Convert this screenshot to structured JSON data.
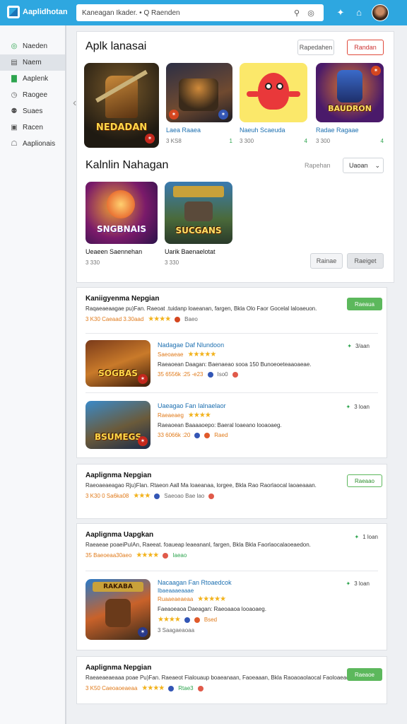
{
  "header": {
    "logo_text": "Aaplidhotan",
    "search_text": "Kaneagan Ikader. • Q Raenden",
    "icons": [
      "search-icon",
      "globe-icon",
      "puzzle-icon",
      "store-icon",
      "avatar"
    ]
  },
  "sidebar": {
    "items": [
      {
        "label": "Naeden",
        "icon": "circle-icon"
      },
      {
        "label": "Naem",
        "icon": "grid-icon",
        "active": true
      },
      {
        "label": "Aaplenk",
        "icon": "chart-icon"
      },
      {
        "label": "Raogee",
        "icon": "clock-icon"
      },
      {
        "label": "Suaes",
        "icon": "people-icon"
      },
      {
        "label": "Racen",
        "icon": "box-icon"
      },
      {
        "label": "Aaplionais",
        "icon": "lock-icon"
      }
    ]
  },
  "featured": {
    "title": "Aplk lanasai",
    "btn_secondary": "Rapedahen",
    "btn_primary": "Randan",
    "tiles": [
      {
        "name": "",
        "art_text": "NEDADAN",
        "size": "",
        "rating": ""
      },
      {
        "name": "Laea Raaea",
        "art_text": "",
        "size": "3 KS8",
        "rating": "1"
      },
      {
        "name": "Naeuh Scaeuda",
        "art_text": "",
        "size": "3 300",
        "rating": "4"
      },
      {
        "name": "Radae Ragaae",
        "art_text": "BAUDRON",
        "size": "3 300",
        "rating": "4"
      }
    ],
    "section2_title": "Kalnlin Nahagan",
    "section2_link": "Rapehan",
    "dropdown_value": "Uaoan",
    "tiles2": [
      {
        "name": "Ueaeen Saennehan",
        "art_text": "SNGBNAIS",
        "size": "3 330"
      },
      {
        "name": "Uarik Baenaelotat",
        "art_text": "SUCGANS",
        "size": "3 330"
      }
    ],
    "pager_prev": "Rainae",
    "pager_next": "Raeiget"
  },
  "list1": {
    "title": "Kaniigyenma Nepgian",
    "desc": "Raqaeaeaagae pu)Fan. Raeoat .tuidanp loaeanan, fargen, Bkla Olo Faor Gocelal laloaeuon.",
    "meta_left": "3 K30   Caeaad 3.30aad",
    "meta_right": "Baeo",
    "btn": "Raeaua",
    "items": [
      {
        "art_text": "SOGBAS",
        "name": "Nadagae Daf Nlundoon",
        "sub": "Saeoaeae",
        "desc": "Raeaoean Daagan: Baenaeao sooa 150 Bunoeoeteaaoaeae.",
        "meta": "35 6556k :25 -e23",
        "meta2": "Iso0",
        "date": "3/aan"
      },
      {
        "art_text": "BSUMEGS",
        "name": "Uaeagao Fan Ialnaelaor",
        "sub": "Raeaeaeg",
        "desc": "Raeaoean Baaaaoepo: Baeral loaeano looaoaeg.",
        "meta": "33 6066k :20",
        "meta2": "Raed",
        "date": "3 loan"
      }
    ]
  },
  "list2": {
    "title": "Aaplignma Nepgian",
    "desc": "Raeoaeaeagao Rju)Flan. Rtaeon Aall Ma loaeanaa, lorgee, Bkla Rao Raorlaocal laoaeaaan.",
    "meta_left": "3 K30   0 Sa6ka08",
    "meta_right": "Saeoao  Bae lao",
    "btn": "Raeaao"
  },
  "list3": {
    "title": "Aaplignma Uapgkan",
    "desc": "Raeaeae poaeiPuIAn, Raeeat. foaueap leaeananl, fargen, Bkla Bkla Faorlaocalaoeaedon.",
    "meta": "35 Baeoeaa30aeo",
    "meta_right": "Iaeao",
    "date": "1 loan",
    "item": {
      "art_text": "RAKABA",
      "name": "Nacaagan Fan Rtoaedcok",
      "sub": "Ibaeaaaeaaae",
      "sub2": "Ruaaeaeaeaa",
      "desc": "Faeaoeaoa Daeagan: Raeoaaoa looaoaeg.",
      "meta": "3 Saagaeaoaa",
      "date": "3 loan",
      "meta_right": "Bsed"
    }
  },
  "list4": {
    "title": "Aaplignma Nepgian",
    "desc": "Raeaeaeaeaaa poae Pu)Fan. Raeaeot Fialouaup boaeanaan, Faoeaaan, Bkla Raoaoaolaocal Faoloaeae.",
    "meta": "3 K50 Caeoaoeaeaa",
    "meta_right": "Rtae3",
    "btn": "Raeaoe"
  }
}
